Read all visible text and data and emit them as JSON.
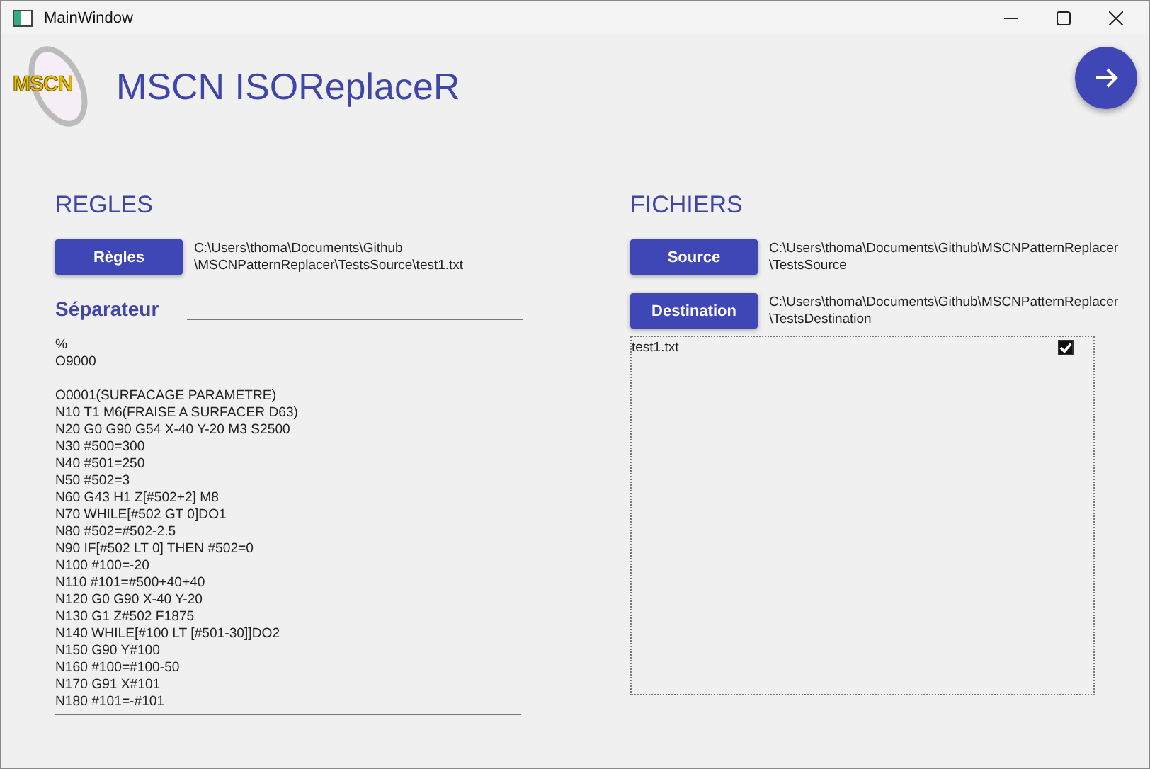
{
  "window": {
    "title": "MainWindow"
  },
  "header": {
    "logo_text": "MSCN",
    "title": "MSCN ISOReplaceR"
  },
  "rules": {
    "heading": "REGLES",
    "button": "Règles",
    "path": "C:\\Users\\thoma\\Documents\\Github\n\\MSCNPatternReplacer\\TestsSource\\test1.txt",
    "separator_label": "Séparateur",
    "code_blocks": [
      [
        "%",
        "O9000"
      ],
      [
        "O0001(SURFACAGE PARAMETRE)",
        "N10 T1 M6(FRAISE A SURFACER D63)",
        "N20 G0 G90 G54 X-40 Y-20 M3 S2500",
        "N30 #500=300",
        "N40 #501=250",
        "N50 #502=3",
        "N60 G43 H1 Z[#502+2] M8",
        "N70 WHILE[#502 GT 0]DO1",
        "N80 #502=#502-2.5",
        "N90 IF[#502 LT 0] THEN #502=0",
        "N100 #100=-20",
        "N110 #101=#500+40+40",
        "N120 G0 G90 X-40 Y-20",
        "N130 G1 Z#502 F1875",
        "N140 WHILE[#100 LT [#501-30]]DO2",
        "N150 G90 Y#100",
        "N160 #100=#100-50",
        "N170 G91 X#101",
        "N180 #101=-#101"
      ]
    ]
  },
  "files": {
    "heading": "FICHIERS",
    "source_button": "Source",
    "source_path": "C:\\Users\\thoma\\Documents\\Github\\MSCNPatternReplacer\n\\TestsSource",
    "destination_button": "Destination",
    "destination_path": "C:\\Users\\thoma\\Documents\\Github\\MSCNPatternReplacer\n\\TestsDestination",
    "items": [
      {
        "name": "test1.txt",
        "checked": true
      }
    ]
  }
}
